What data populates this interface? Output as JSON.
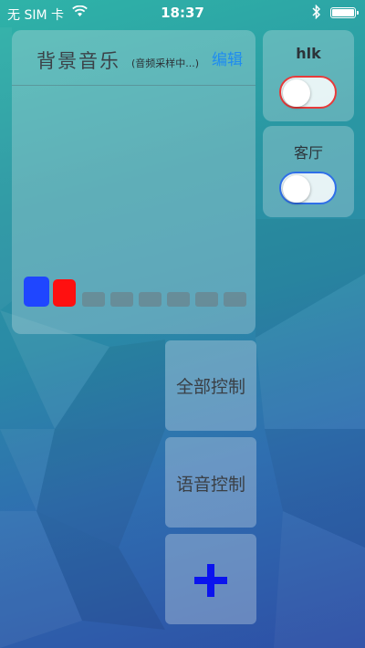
{
  "status_bar": {
    "carrier": "无 SIM 卡",
    "time": "18:37",
    "wifi_icon": "wifi-icon",
    "bluetooth_icon": "bluetooth-icon",
    "battery_icon": "battery-icon"
  },
  "music": {
    "title": "背景音乐",
    "subtitle": "(音频采样中...)",
    "edit_label": "编辑",
    "levels": [
      {
        "state": "active",
        "color": "#1f46ff"
      },
      {
        "state": "active",
        "color": "#ff1010"
      },
      {
        "state": "inactive"
      },
      {
        "state": "inactive"
      },
      {
        "state": "inactive"
      },
      {
        "state": "inactive"
      },
      {
        "state": "inactive"
      },
      {
        "state": "inactive"
      }
    ]
  },
  "devices": [
    {
      "name": "hlk",
      "accent": "#e06a6a",
      "toggle_border": "#e83a3a",
      "on": false
    },
    {
      "name": "客厅",
      "accent": "#4f8de8",
      "toggle_border": "#2f6fe8",
      "on": false
    }
  ],
  "controls": {
    "all_control_label": "全部控制",
    "voice_control_label": "语音控制",
    "add_icon": "plus-icon",
    "add_color": "#0a13ee"
  }
}
